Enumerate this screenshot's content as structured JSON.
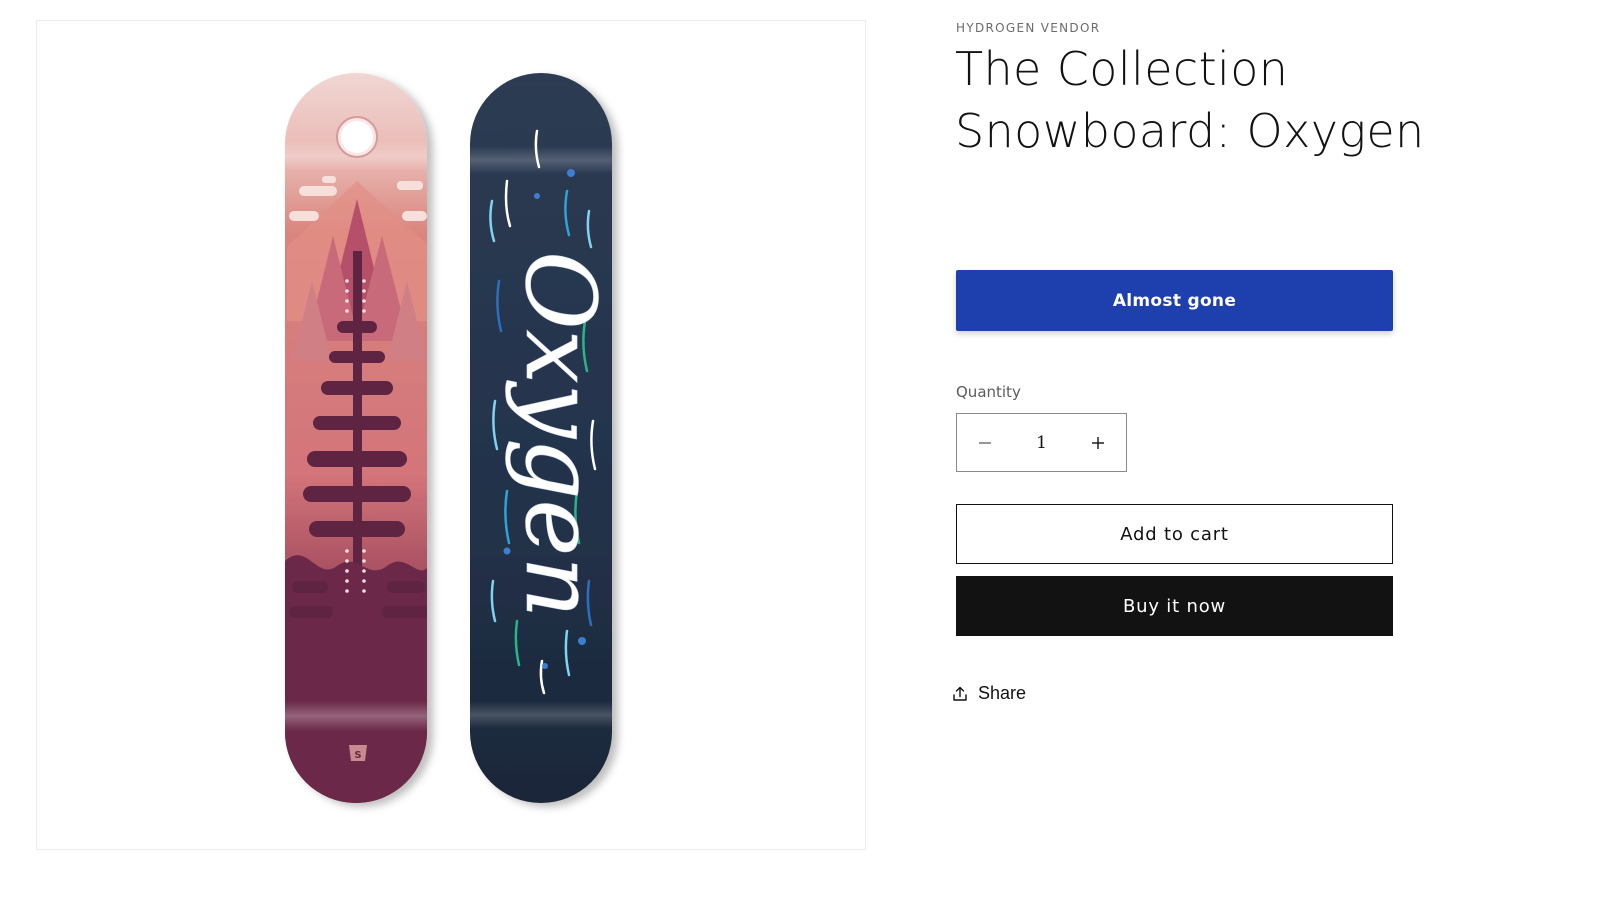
{
  "product": {
    "vendor": "HYDROGEN VENDOR",
    "title": "The Collection Snowboard: Oxygen",
    "image_alt": "Oxygen snowboard top and base",
    "board_lettering": "Oxygen"
  },
  "availability": {
    "label": "Almost gone"
  },
  "quantity": {
    "label": "Quantity",
    "value": "1",
    "decrease_icon": "minus-icon",
    "increase_icon": "plus-icon"
  },
  "actions": {
    "add_to_cart": "Add to cart",
    "buy_now": "Buy it now",
    "share": "Share",
    "share_icon": "share-icon"
  },
  "colors": {
    "accent": "#1e3fae",
    "buy_now_bg": "#121212",
    "text": "#121212"
  }
}
